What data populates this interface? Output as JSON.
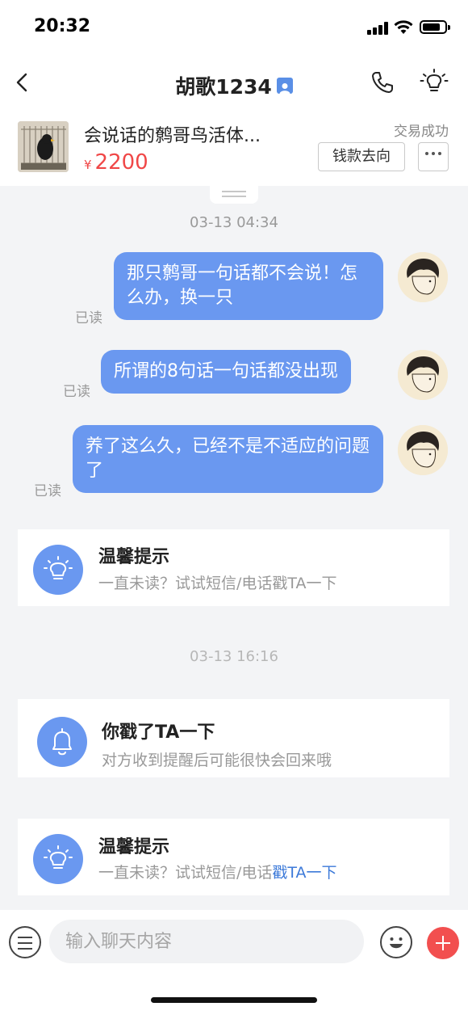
{
  "status": {
    "time": "20:32"
  },
  "nav": {
    "title": "胡歌1234"
  },
  "product": {
    "title": "会说话的鹩哥鸟活体...",
    "currency": "¥",
    "price": "2200",
    "trade_status": "交易成功",
    "money_button": "钱款去向"
  },
  "chat": {
    "timestamp1": "03-13 04:34",
    "messages": [
      {
        "text": "那只鹩哥一句话都不会说！怎么办，换一只",
        "read": "已读"
      },
      {
        "text": "所谓的8句话一句话都没出现",
        "read": "已读"
      },
      {
        "text": "养了这么久，已经不是不适应的问题了",
        "read": "已读"
      }
    ],
    "tip1": {
      "title": "温馨提示",
      "sub": "一直未读？试试短信/电话戳TA一下"
    },
    "timestamp2": "03-13 16:16",
    "poke": {
      "title": "你戳了TA一下",
      "sub": "对方收到提醒后可能很快会回来哦"
    },
    "tip2": {
      "title": "温馨提示",
      "sub_prefix": "一直未读？试试短信/电话",
      "sub_link": "戳TA一下"
    }
  },
  "input": {
    "placeholder": "输入聊天内容"
  }
}
